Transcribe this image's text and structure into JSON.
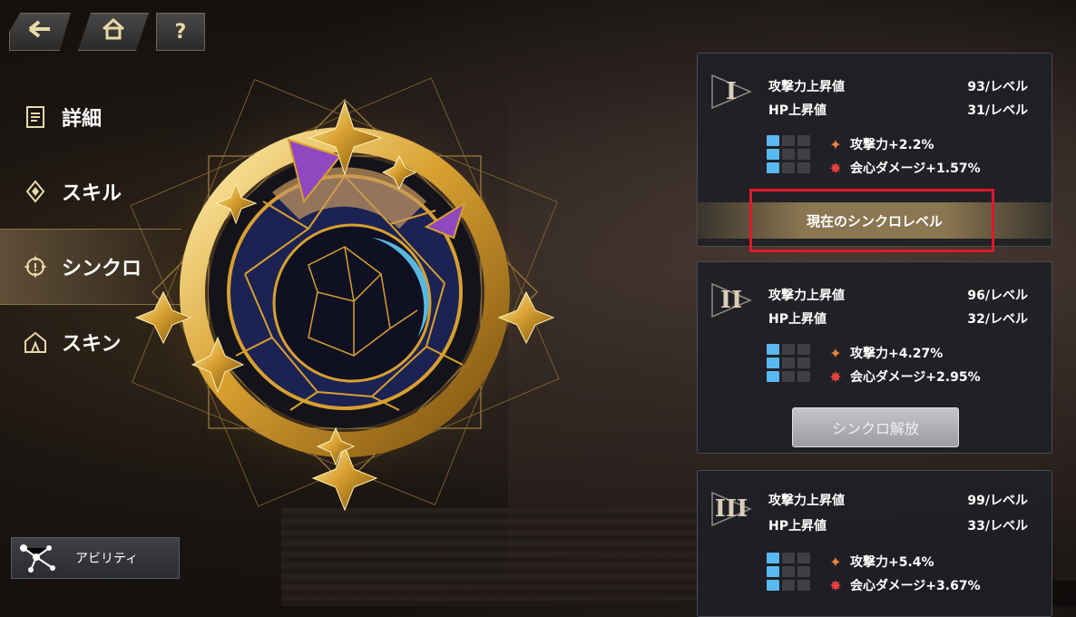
{
  "nav": {
    "back_icon": "back-arrow-icon",
    "home_icon": "home-icon",
    "help_label": "?"
  },
  "menu": [
    {
      "label": "詳細",
      "icon": "document-icon",
      "active": false
    },
    {
      "label": "スキル",
      "icon": "skill-icon",
      "active": false
    },
    {
      "label": "シンクロ",
      "icon": "synchro-icon",
      "active": true
    },
    {
      "label": "スキン",
      "icon": "skin-icon",
      "active": false
    }
  ],
  "ability": {
    "label": "アビリティ"
  },
  "panels": [
    {
      "roman": "I",
      "stat1_label": "攻撃力上昇値",
      "stat1_value": "93/レベル",
      "stat2_label": "HP上昇値",
      "stat2_value": "31/レベル",
      "bonus_atk": "攻撃力+2.2%",
      "bonus_crit": "会心ダメージ+1.57%",
      "action": "現在のシンクロレベル"
    },
    {
      "roman": "II",
      "stat1_label": "攻撃力上昇値",
      "stat1_value": "96/レベル",
      "stat2_label": "HP上昇値",
      "stat2_value": "32/レベル",
      "bonus_atk": "攻撃力+4.27%",
      "bonus_crit": "会心ダメージ+2.95%",
      "action": "シンクロ解放"
    },
    {
      "roman": "III",
      "stat1_label": "攻撃力上昇値",
      "stat1_value": "99/レベル",
      "stat2_label": "HP上昇値",
      "stat2_value": "33/レベル",
      "bonus_atk": "攻撃力+5.4%",
      "bonus_crit": "会心ダメージ+3.67%"
    }
  ],
  "colors": {
    "accent_gold": "#e8c060",
    "grid_active": "#58b8f0",
    "highlight": "#e0182a"
  }
}
